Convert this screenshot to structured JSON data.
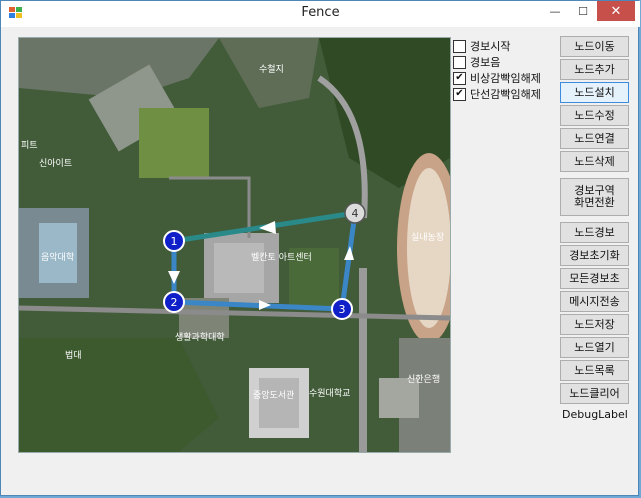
{
  "window": {
    "title": "Fence",
    "min_glyph": "—",
    "max_glyph": "☐",
    "close_glyph": "✕"
  },
  "checkboxes": [
    {
      "label": "경보시작",
      "checked": false
    },
    {
      "label": "경보음",
      "checked": false
    },
    {
      "label": "비상감빡임해제",
      "checked": true
    },
    {
      "label": "단선감빡임해제",
      "checked": true
    }
  ],
  "buttons": {
    "move": "노드이동",
    "add": "노드추가",
    "install": "노드설치",
    "edit": "노드수정",
    "connect": "노드연결",
    "delete": "노드삭제",
    "area_line1": "경보구역",
    "area_line2": "화면전환",
    "alarm": "노드경보",
    "alarm_reset": "경보초기화",
    "all_reset": "모든경보초",
    "send": "메시지전송",
    "save": "노드저장",
    "open": "노드열기",
    "list": "노드목록",
    "clear": "노드클리어"
  },
  "debug_label": "DebugLabel",
  "map": {
    "nodes": [
      {
        "id": "1",
        "state": "active"
      },
      {
        "id": "2",
        "state": "active"
      },
      {
        "id": "3",
        "state": "active"
      },
      {
        "id": "4",
        "state": "inactive"
      }
    ],
    "labels": [
      "수철지",
      "피트",
      "신아이트",
      "음악대학",
      "벨칸토 아트센터",
      "생활과학대학",
      "법대",
      "수원대학교",
      "중앙도서관",
      "실내농장",
      "신한은행"
    ]
  },
  "colors": {
    "node_active": "#1020c8",
    "node_inactive": "#dcdcdc",
    "line_blue": "#3a86c6",
    "line_teal": "#2a8a8a",
    "close": "#c7504b"
  }
}
